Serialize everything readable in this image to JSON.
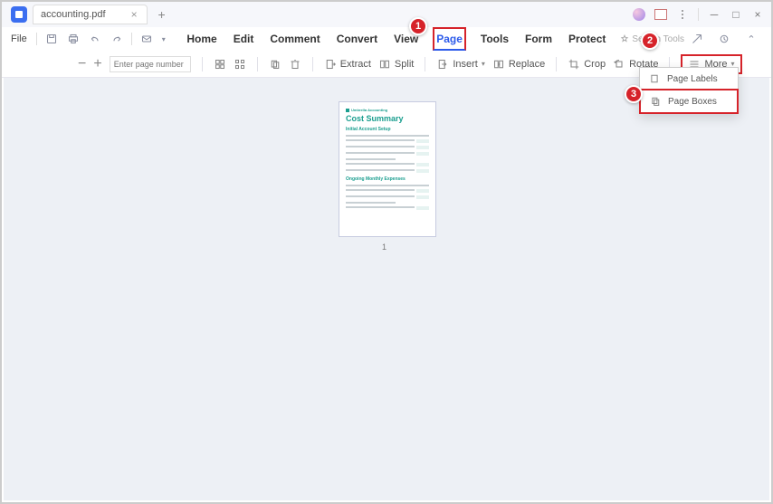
{
  "titlebar": {
    "tab_name": "accounting.pdf"
  },
  "menubar": {
    "file": "File",
    "tabs": {
      "home": "Home",
      "edit": "Edit",
      "comment": "Comment",
      "convert": "Convert",
      "view": "View",
      "page": "Page",
      "tools": "Tools",
      "form": "Form",
      "protect": "Protect"
    },
    "search_placeholder": "Search Tools"
  },
  "toolbar": {
    "page_placeholder": "Enter page number",
    "extract": "Extract",
    "split": "Split",
    "insert": "Insert",
    "replace": "Replace",
    "crop": "Crop",
    "rotate": "Rotate",
    "more": "More"
  },
  "dropdown": {
    "page_labels": "Page Labels",
    "page_boxes": "Page Boxes"
  },
  "thumbnail": {
    "brand": "Umbrella Accounting",
    "title": "Cost Summary",
    "section1": "Initial Account Setup",
    "section2": "Ongoing Monthly Expenses",
    "page_number": "1"
  },
  "annotations": {
    "step1": "1",
    "step2": "2",
    "step3": "3"
  }
}
